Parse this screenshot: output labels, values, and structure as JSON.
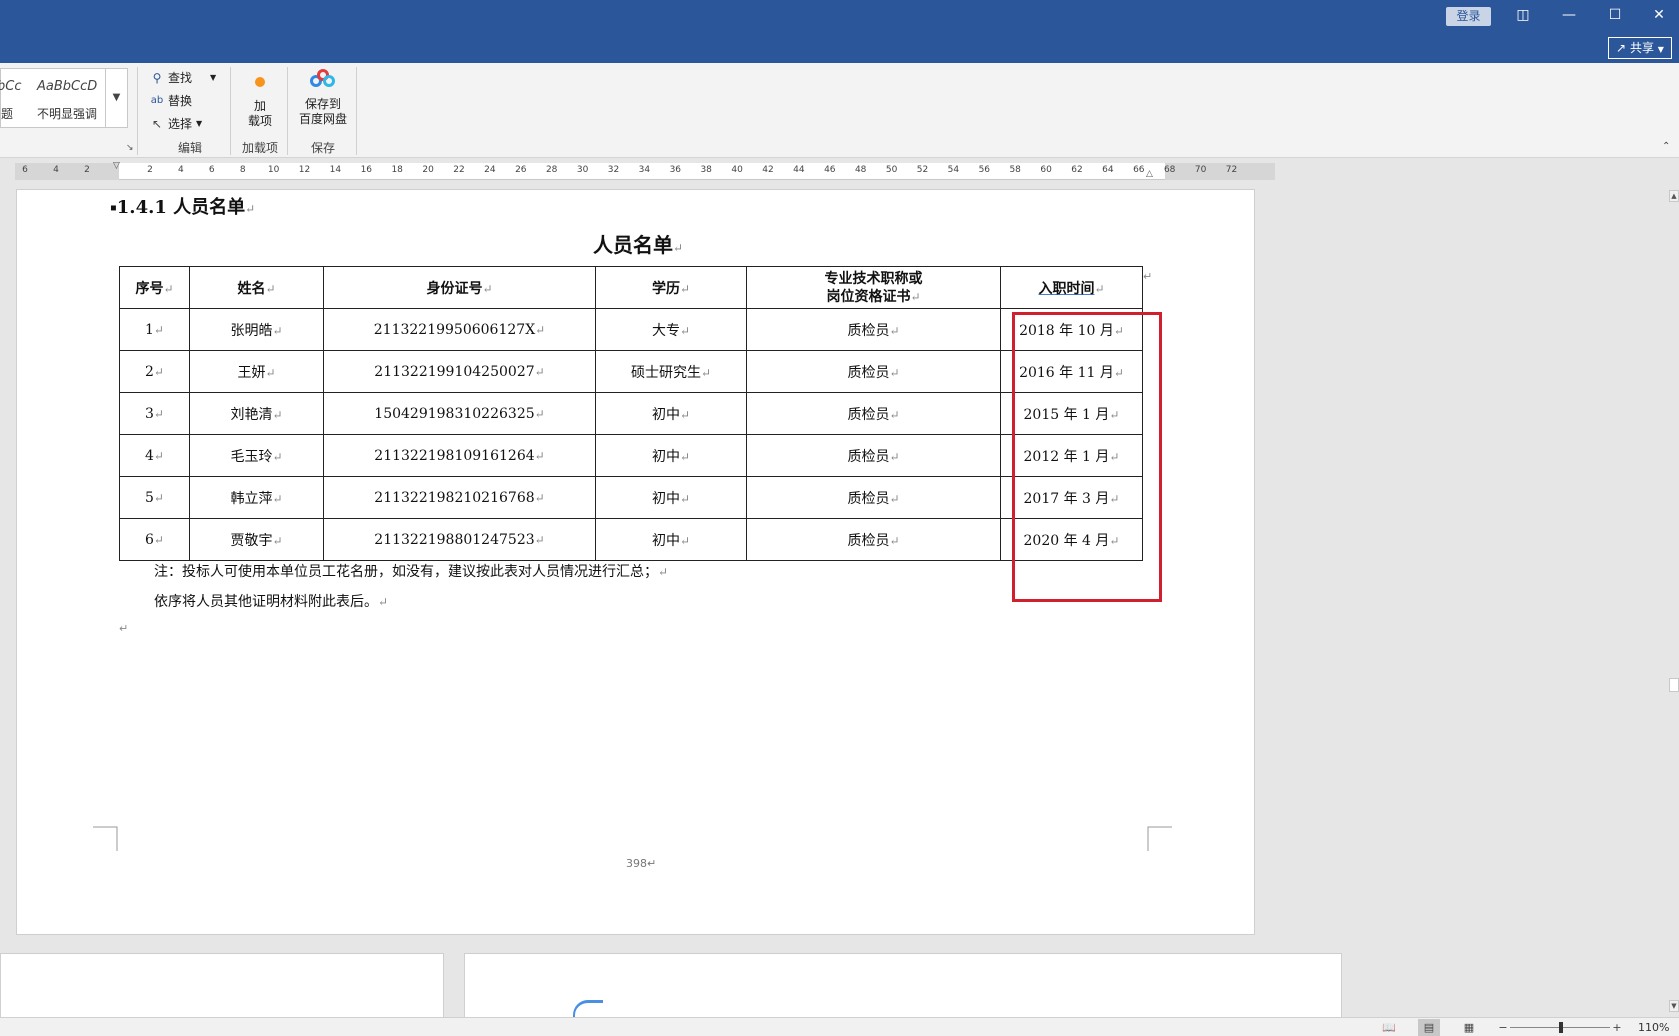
{
  "titlebar": {
    "login": "登录",
    "share": "共享"
  },
  "ribbon": {
    "styles": [
      {
        "sample": "bCc",
        "name": "题"
      },
      {
        "sample": "AaBbCcD",
        "name": "不明显强调"
      }
    ],
    "editing": {
      "find": "查找",
      "replace": "替换",
      "select": "选择",
      "group_label": "编辑"
    },
    "addins": {
      "button": "加\n载项",
      "button_line1": "加",
      "button_line2": "载项",
      "group_label": "加载项"
    },
    "save": {
      "button_line1": "保存到",
      "button_line2": "百度网盘",
      "group_label": "保存"
    }
  },
  "ruler": {
    "left_numbers": [
      "6",
      "4",
      "2"
    ],
    "numbers": [
      "2",
      "4",
      "6",
      "8",
      "10",
      "12",
      "14",
      "16",
      "18",
      "20",
      "22",
      "24",
      "26",
      "28",
      "30",
      "32",
      "34",
      "36",
      "38",
      "40",
      "42",
      "44",
      "46",
      "48",
      "50",
      "52",
      "54",
      "56",
      "58",
      "60",
      "62",
      "64",
      "66",
      "68",
      "70",
      "72"
    ]
  },
  "document": {
    "heading": "1.4.1 人员名单",
    "title": "人员名单",
    "table": {
      "headers": [
        "序号",
        "姓名",
        "身份证号",
        "学历",
        "专业技术职称或\n岗位资格证书",
        "入职时间"
      ],
      "header_cert_line1": "专业技术职称或",
      "header_cert_line2": "岗位资格证书",
      "rows": [
        [
          "1",
          "张明皓",
          "21132219950606127X",
          "大专",
          "质检员",
          "2018 年 10 月"
        ],
        [
          "2",
          "王妍",
          "211322199104250027",
          "硕士研究生",
          "质检员",
          "2016 年 11 月"
        ],
        [
          "3",
          "刘艳清",
          "150429198310226325",
          "初中",
          "质检员",
          "2015 年 1 月"
        ],
        [
          "4",
          "毛玉玲",
          "211322198109161264",
          "初中",
          "质检员",
          "2012 年 1 月"
        ],
        [
          "5",
          "韩立萍",
          "211322198210216768",
          "初中",
          "质检员",
          "2017 年 3 月"
        ],
        [
          "6",
          "贾敬宇",
          "211322198801247523",
          "初中",
          "质检员",
          "2020 年 4 月"
        ]
      ]
    },
    "note_line1": "注：投标人可使用本单位员工花名册，如没有，建议按此表对人员情况进行汇总；",
    "note_line2": "依序将人员其他证明材料附此表后。",
    "page_number": "398"
  },
  "statusbar": {
    "zoom": "110%"
  },
  "colors": {
    "titlebar": "#2b579a",
    "highlight": "#d0202e"
  }
}
